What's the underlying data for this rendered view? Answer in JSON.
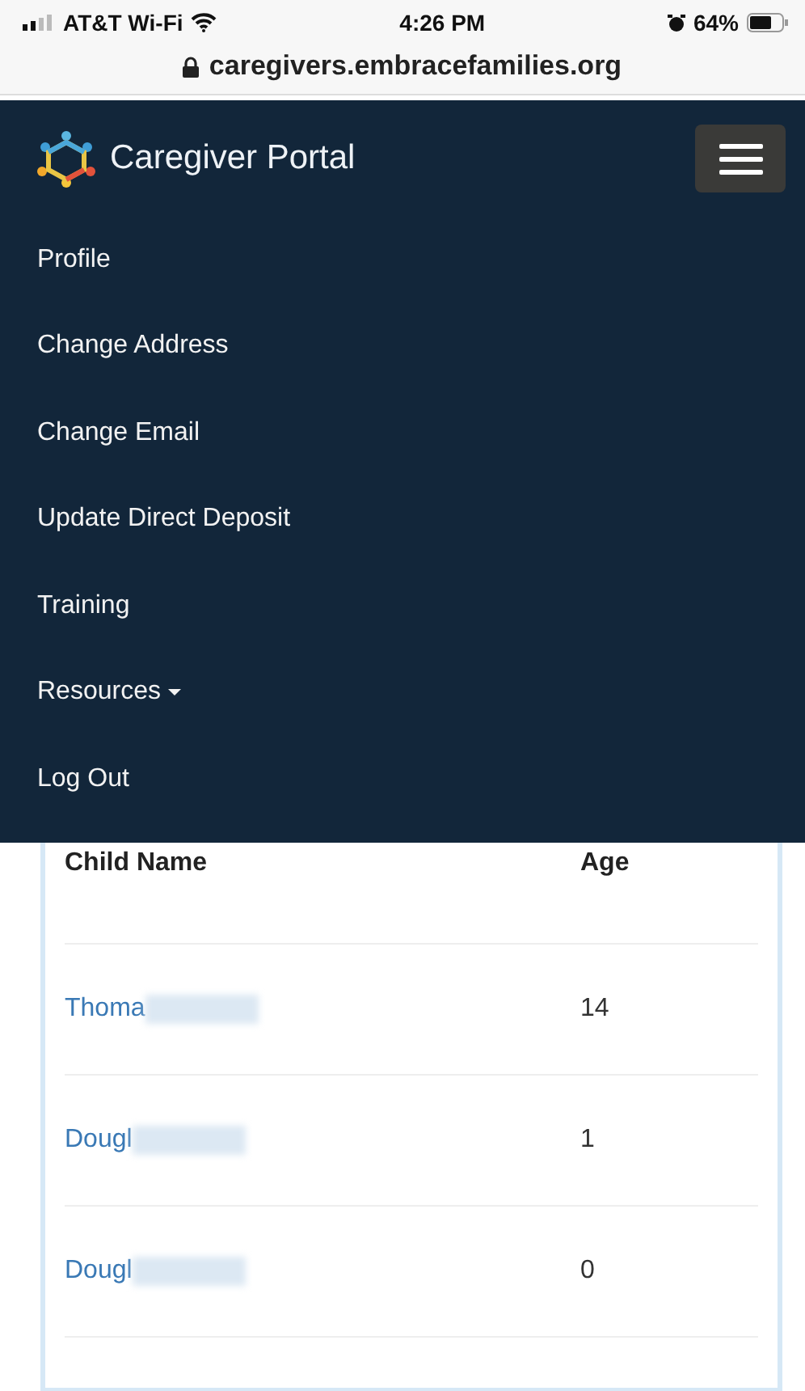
{
  "status_bar": {
    "carrier": "AT&T Wi-Fi",
    "time": "4:26 PM",
    "battery": "64%"
  },
  "address_bar": {
    "url": "caregivers.embracefamilies.org"
  },
  "navbar": {
    "brand": "Caregiver Portal",
    "items": [
      {
        "label": "Profile",
        "kind": "link"
      },
      {
        "label": "Change Address",
        "kind": "link"
      },
      {
        "label": "Change Email",
        "kind": "link"
      },
      {
        "label": "Update Direct Deposit",
        "kind": "link"
      },
      {
        "label": "Training",
        "kind": "link"
      },
      {
        "label": "Resources",
        "kind": "dropdown"
      },
      {
        "label": "Log Out",
        "kind": "link"
      }
    ]
  },
  "table": {
    "columns": [
      "Child Name",
      "Age"
    ],
    "rows": [
      {
        "name": "Thoma",
        "age": "14"
      },
      {
        "name": "Dougl",
        "age": "1"
      },
      {
        "name": "Dougl",
        "age": "0"
      }
    ]
  }
}
